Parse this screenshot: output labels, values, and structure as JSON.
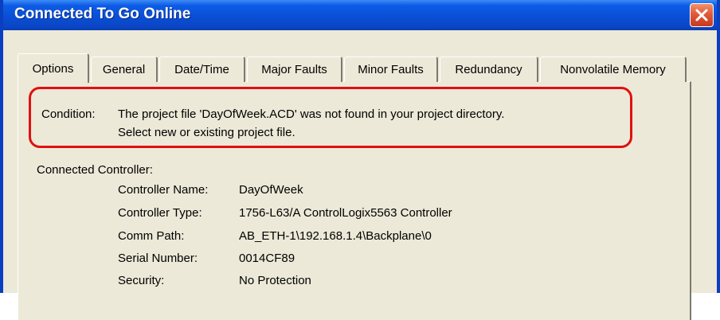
{
  "window": {
    "title": "Connected To Go Online"
  },
  "tabs": [
    {
      "label": "Options",
      "active": true
    },
    {
      "label": "General"
    },
    {
      "label": "Date/Time"
    },
    {
      "label": "Major Faults"
    },
    {
      "label": "Minor Faults"
    },
    {
      "label": "Redundancy"
    },
    {
      "label": "Nonvolatile Memory"
    }
  ],
  "condition": {
    "label": "Condition:",
    "line1": "The project file 'DayOfWeek.ACD' was not found in your project directory.",
    "line2": "Select new or existing project file.",
    "highlight_color": "#e01010"
  },
  "connected_controller": {
    "heading": "Connected Controller:",
    "fields": [
      {
        "label": "Controller Name:",
        "value": "DayOfWeek"
      },
      {
        "label": "Controller Type:",
        "value": "1756-L63/A ControlLogix5563 Controller"
      },
      {
        "label": "Comm Path:",
        "value": "AB_ETH-1\\192.168.1.4\\Backplane\\0"
      },
      {
        "label": "Serial Number:",
        "value": "0014CF89"
      },
      {
        "label": "Security:",
        "value": "No Protection"
      }
    ]
  }
}
